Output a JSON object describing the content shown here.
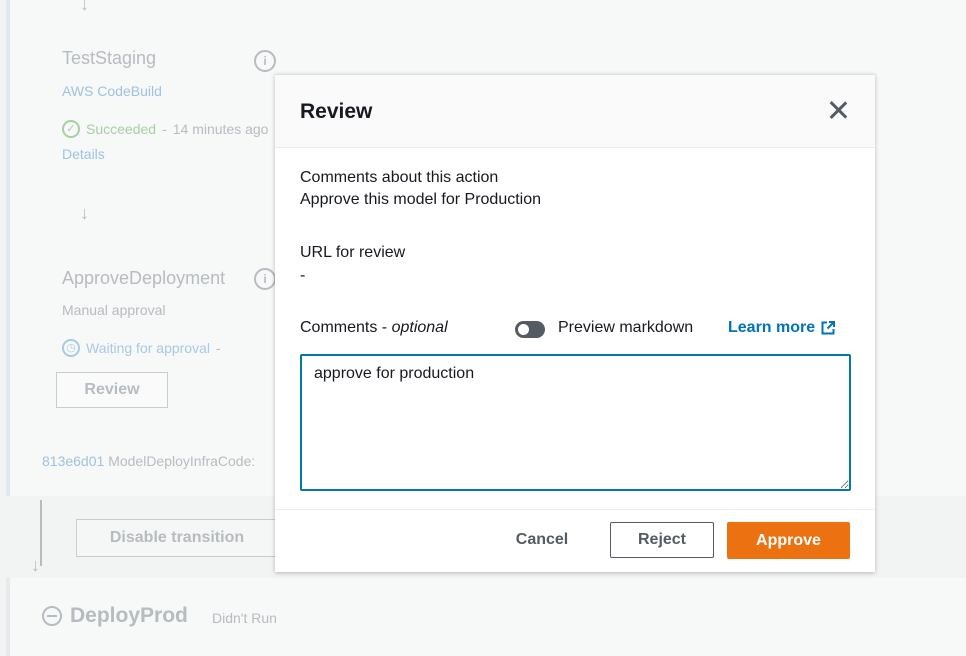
{
  "background": {
    "test_staging": {
      "title": "TestStaging",
      "provider": "AWS CodeBuild",
      "status": "Succeeded",
      "separator": "-",
      "time": "14 minutes ago",
      "details_link": "Details"
    },
    "approve_deployment": {
      "title": "ApproveDeployment",
      "provider": "Manual approval",
      "status": "Waiting for approval",
      "separator": "-",
      "review_button": "Review"
    },
    "commit": {
      "id": "813e6d01",
      "message": "ModelDeployInfraCode:"
    },
    "disable_transition_button": "Disable transition",
    "deploy_prod": {
      "title": "DeployProd",
      "status": "Didn't Run"
    }
  },
  "modal": {
    "title": "Review",
    "comments_about_label": "Comments about this action",
    "comments_about_value": "Approve this model for Production",
    "url_label": "URL for review",
    "url_value": "-",
    "comments_label": "Comments -",
    "comments_optional": "optional",
    "preview_markdown_label": "Preview markdown",
    "preview_markdown_on": false,
    "learn_more_label": "Learn more",
    "comments_value": "approve for production",
    "buttons": {
      "cancel": "Cancel",
      "reject": "Reject",
      "approve": "Approve"
    }
  },
  "colors": {
    "accent": "#ec7211",
    "link": "#0073bb",
    "focus": "#0078a8"
  }
}
